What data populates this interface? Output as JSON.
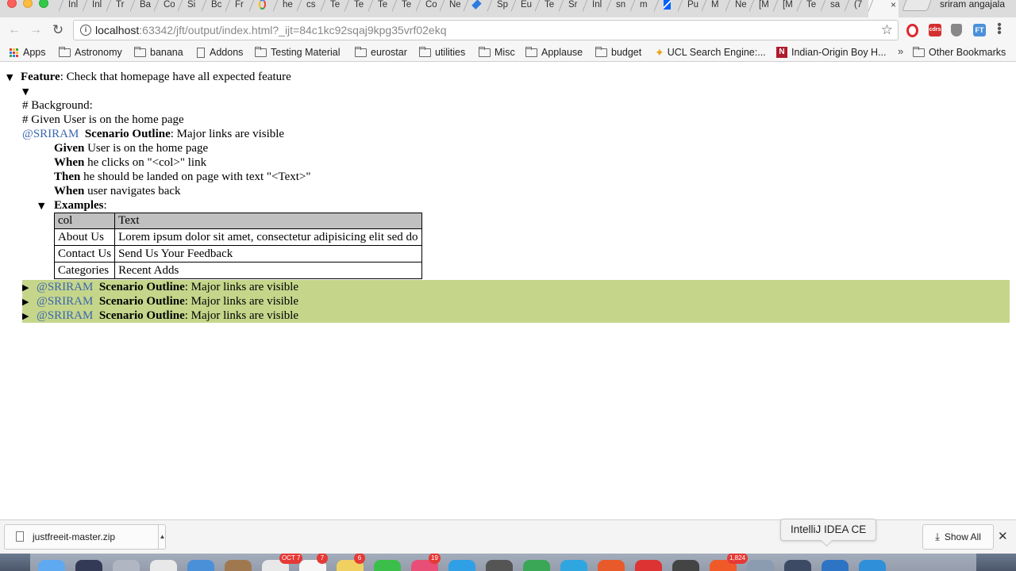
{
  "browser": {
    "tabs": [
      {
        "label": "Inl"
      },
      {
        "label": "Inl"
      },
      {
        "label": "Tr"
      },
      {
        "label": "Ba"
      },
      {
        "label": "Co"
      },
      {
        "label": "Si"
      },
      {
        "label": "Bc"
      },
      {
        "label": "Fr"
      },
      {
        "label": "",
        "icon": "google-icon"
      },
      {
        "label": "he"
      },
      {
        "label": "cs"
      },
      {
        "label": "Te"
      },
      {
        "label": "Te"
      },
      {
        "label": "Te"
      },
      {
        "label": "Te"
      },
      {
        "label": "Co"
      },
      {
        "label": "Ne"
      },
      {
        "label": "",
        "icon": "jira-icon"
      },
      {
        "label": "Sp"
      },
      {
        "label": "Eu"
      },
      {
        "label": "Te"
      },
      {
        "label": "Sr"
      },
      {
        "label": "Inl"
      },
      {
        "label": "sn"
      },
      {
        "label": "m"
      },
      {
        "label": "",
        "icon": "dropbox-icon"
      },
      {
        "label": "Pu"
      },
      {
        "label": "M"
      },
      {
        "label": "Ne"
      },
      {
        "label": "[M"
      },
      {
        "label": "[M"
      },
      {
        "label": "Te"
      },
      {
        "label": "sa"
      },
      {
        "label": "(7"
      },
      {
        "label": "",
        "active": true
      }
    ],
    "profile_name": "sriram angajala",
    "url_host": "localhost",
    "url_rest": ":63342/jft/output/index.html?_ijt=84c1kc92sqaj9kpg35vrf02ekq",
    "bookmarks": {
      "apps": "Apps",
      "astronomy": "Astronomy",
      "banana": "banana",
      "addons": "Addons",
      "testing_material": "Testing Material",
      "eurostar": "eurostar",
      "utilities": "utilities",
      "misc": "Misc",
      "applause": "Applause",
      "budget": "budget",
      "ucl": "UCL Search Engine:...",
      "indian_origin": "Indian-Origin Boy H...",
      "more": "»",
      "other": "Other Bookmarks"
    },
    "extension_labels": {
      "cdrs": "cdrs",
      "ft": "FT"
    }
  },
  "report": {
    "feature_keyword": "Feature",
    "feature_title": ": Check that homepage have all expected feature",
    "background_line": "# Background:",
    "given_comment": "# Given User is on the home page",
    "tag": "@SRIRAM",
    "scenario_keyword": "Scenario Outline",
    "scenario_title": ": Major links are visible",
    "steps": [
      {
        "keyword": "Given",
        "text": " User is on the home page"
      },
      {
        "keyword": "When",
        "text": " he clicks on \"<col>\" link"
      },
      {
        "keyword": "Then",
        "text": " he should be landed on page with text \"<Text>\""
      },
      {
        "keyword": "When",
        "text": " user navigates back"
      }
    ],
    "examples_keyword": "Examples",
    "examples_colon": ":",
    "table": {
      "headers": [
        "col",
        "Text"
      ],
      "rows": [
        [
          "About Us",
          "Lorem ipsum dolor sit amet, consectetur adipisicing elit sed do"
        ],
        [
          "Contact Us",
          "Send Us Your Feedback"
        ],
        [
          "Categories",
          "Recent Adds"
        ]
      ]
    },
    "collapsed_scenarios": [
      {
        "tag": "@SRIRAM",
        "keyword": "Scenario Outline",
        "title": ": Major links are visible"
      },
      {
        "tag": "@SRIRAM",
        "keyword": "Scenario Outline",
        "title": ": Major links are visible"
      },
      {
        "tag": "@SRIRAM",
        "keyword": "Scenario Outline",
        "title": ": Major links are visible"
      }
    ],
    "colors": {
      "tag": "#3a66b0",
      "passed_highlight": "#c5d68b",
      "table_header": "#c0c0c0"
    }
  },
  "downloads": {
    "file_name": "justfreeit-master.zip",
    "tooltip": "IntelliJ IDEA CE",
    "show_all": "Show All"
  },
  "dock": {
    "badges": [
      "OCT 7",
      "7",
      "6",
      "19",
      "1,824"
    ]
  }
}
